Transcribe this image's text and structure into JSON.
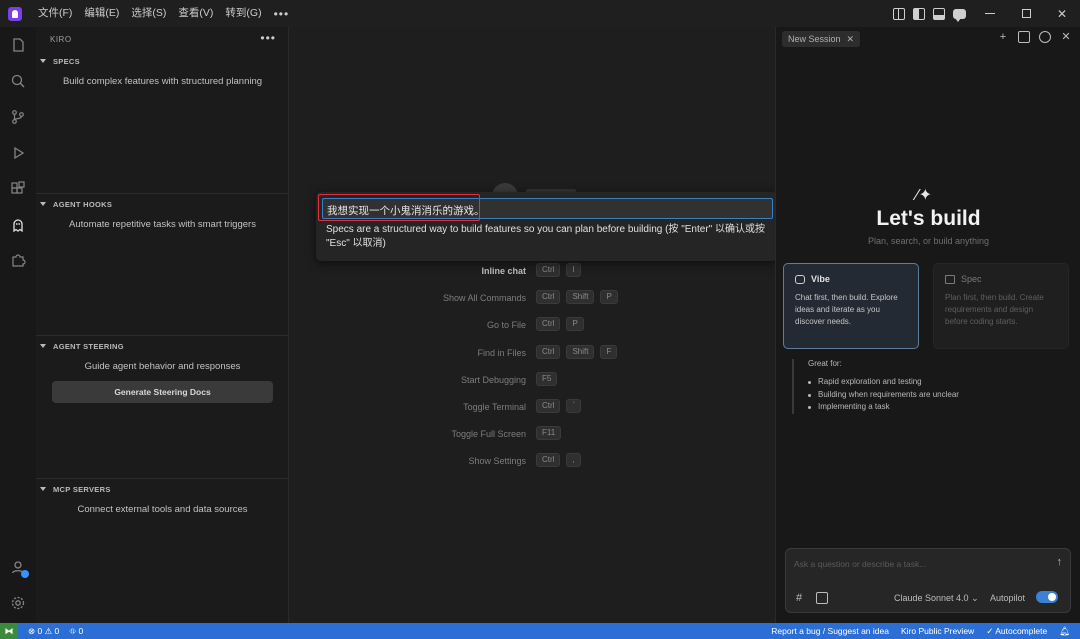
{
  "menu": {
    "items": [
      "文件(F)",
      "编辑(E)",
      "选择(S)",
      "查看(V)",
      "转到(G)"
    ],
    "more": "•••"
  },
  "window_controls": {
    "close": "✕"
  },
  "sidebar": {
    "title": "KIRO",
    "more": "•••",
    "sections": [
      {
        "title": "SPECS",
        "desc": "Build complex features with structured planning"
      },
      {
        "title": "AGENT HOOKS",
        "desc": "Automate repetitive tasks with smart triggers"
      },
      {
        "title": "AGENT STEERING",
        "desc": "Guide agent behavior and responses",
        "button": "Generate Steering Docs"
      },
      {
        "title": "MCP SERVERS",
        "desc": "Connect external tools and data sources"
      }
    ]
  },
  "editor": {
    "shortcuts": [
      {
        "label": "Inline chat",
        "keys": [
          "Ctrl",
          "I"
        ],
        "bright": true
      },
      {
        "label": "Show All Commands",
        "keys": [
          "Ctrl",
          "Shift",
          "P"
        ]
      },
      {
        "label": "Go to File",
        "keys": [
          "Ctrl",
          "P"
        ]
      },
      {
        "label": "Find in Files",
        "keys": [
          "Ctrl",
          "Shift",
          "F"
        ]
      },
      {
        "label": "Start Debugging",
        "keys": [
          "F5"
        ]
      },
      {
        "label": "Toggle Terminal",
        "keys": [
          "Ctrl",
          "`"
        ]
      },
      {
        "label": "Toggle Full Screen",
        "keys": [
          "F11"
        ]
      },
      {
        "label": "Show Settings",
        "keys": [
          "Ctrl",
          ","
        ]
      }
    ]
  },
  "palette": {
    "input_value": "我想实现一个小鬼消消乐的游戏。",
    "message": "Specs are a structured way to build features so you can plan before building (按 \"Enter\" 以确认或按 \"Esc\" 以取消)"
  },
  "panel": {
    "tab_label": "New Session",
    "heading": "Let's build",
    "subheading": "Plan, search, or build anything",
    "vibe": {
      "title": "Vibe",
      "desc": "Chat first, then build. Explore ideas and iterate as you discover needs."
    },
    "spec": {
      "title": "Spec",
      "desc": "Plan first, then build. Create requirements and design before coding starts."
    },
    "great_for": {
      "title": "Great for:",
      "items": [
        "Rapid exploration and testing",
        "Building when requirements are unclear",
        "Implementing a task"
      ]
    },
    "chat": {
      "placeholder": "Ask a question or describe a task...",
      "model": "Claude Sonnet 4.0",
      "autopilot_label": "Autopilot",
      "autopilot_on": true
    }
  },
  "status": {
    "problems": "⊗ 0 ⚠ 0",
    "ports": "⛗ 0",
    "report": "Report a bug / Suggest an idea",
    "preview": "Kiro Public Preview",
    "autocomplete": "✓ Autocomplete"
  },
  "colors": {
    "accent": "#2b6fd6",
    "highlight_box": "#e0303a",
    "vibe_border": "#5f7d99"
  }
}
